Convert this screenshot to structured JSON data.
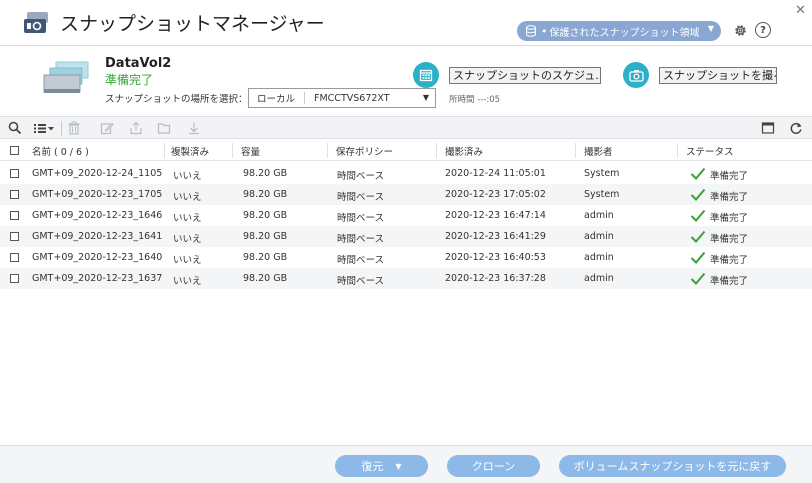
{
  "app": {
    "title": "スナップショットマネージャー",
    "icon": "snapshot-manager-icon"
  },
  "header": {
    "protected_area_label": "保護されたスナップショット領域",
    "accent": "#8aa6d2",
    "help_label": "?"
  },
  "volume": {
    "name": "DataVol2",
    "status": "準備完了",
    "status_color": "#3aa335",
    "location_label": "スナップショットの場所を選択：",
    "location_value": "ローカル",
    "location_host": "FMCCTVS672XT",
    "time_label": "所時間 ---:05"
  },
  "actions": {
    "schedule_label": "スナップショットのスケジュ...",
    "take_label": "スナップショットを撮る",
    "accent": "#2ab0c9"
  },
  "table": {
    "columns": [
      "名前 ( 0 / 6 )",
      "複製済み",
      "容量",
      "保存ポリシー",
      "撮影済み",
      "撮影者",
      "ステータス"
    ],
    "rows": [
      {
        "name": "GMT+09_2020-12-24_1105",
        "replicated": "いいえ",
        "size": "98.20 GB",
        "policy": "時間ベース",
        "taken": "2020-12-24 11:05:01",
        "by": "System",
        "status": "準備完了"
      },
      {
        "name": "GMT+09_2020-12-23_1705",
        "replicated": "いいえ",
        "size": "98.20 GB",
        "policy": "時間ベース",
        "taken": "2020-12-23 17:05:02",
        "by": "System",
        "status": "準備完了"
      },
      {
        "name": "GMT+09_2020-12-23_1646",
        "replicated": "いいえ",
        "size": "98.20 GB",
        "policy": "時間ベース",
        "taken": "2020-12-23 16:47:14",
        "by": "admin",
        "status": "準備完了"
      },
      {
        "name": "GMT+09_2020-12-23_1641",
        "replicated": "いいえ",
        "size": "98.20 GB",
        "policy": "時間ベース",
        "taken": "2020-12-23 16:41:29",
        "by": "admin",
        "status": "準備完了"
      },
      {
        "name": "GMT+09_2020-12-23_1640",
        "replicated": "いいえ",
        "size": "98.20 GB",
        "policy": "時間ベース",
        "taken": "2020-12-23 16:40:53",
        "by": "admin",
        "status": "準備完了"
      },
      {
        "name": "GMT+09_2020-12-23_1637",
        "replicated": "いいえ",
        "size": "98.20 GB",
        "policy": "時間ベース",
        "taken": "2020-12-23 16:37:28",
        "by": "admin",
        "status": "準備完了"
      }
    ]
  },
  "footer": {
    "restore_label": "復元",
    "clone_label": "クローン",
    "revert_label": "ボリュームスナップショットを元に戻す",
    "button_color": "#8cb9e8"
  }
}
